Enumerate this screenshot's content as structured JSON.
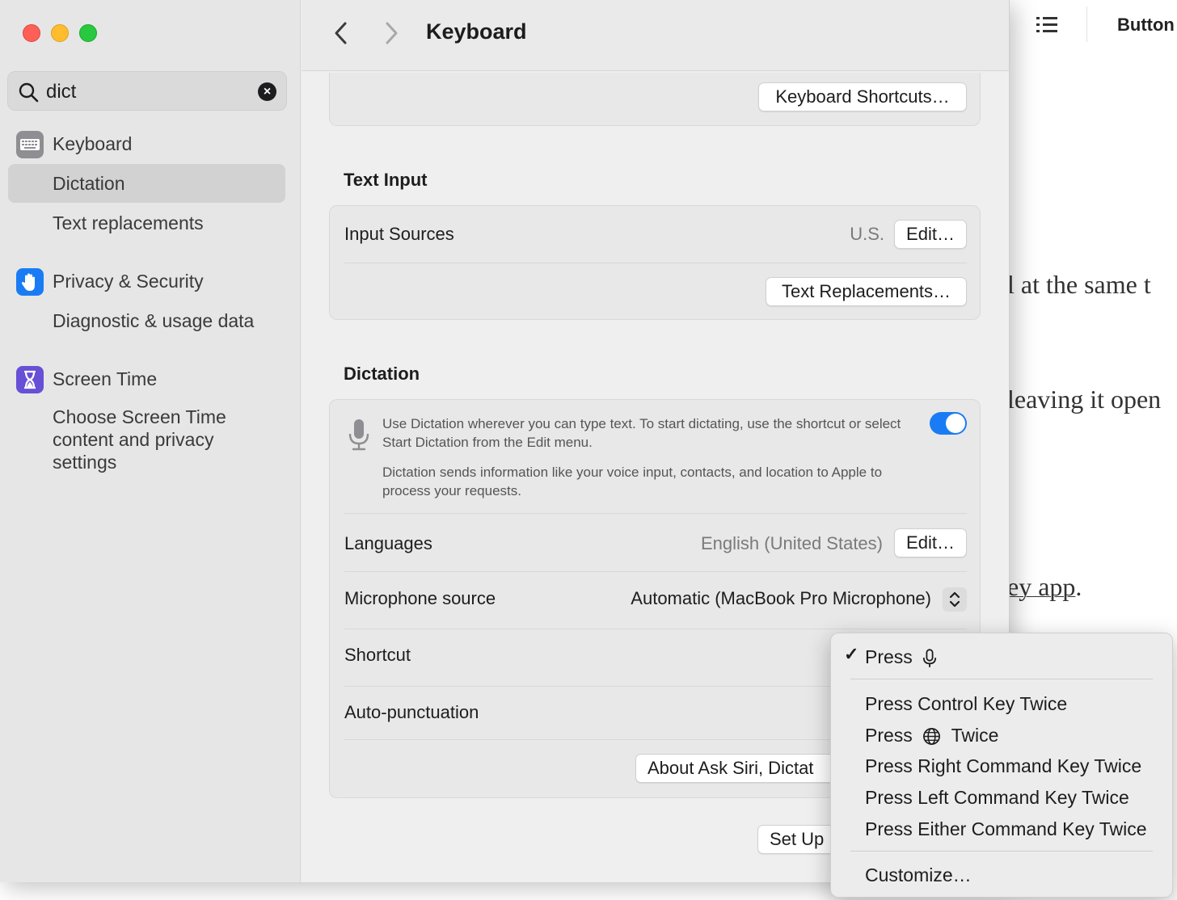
{
  "background_app": {
    "toolbar_button_label": "Button",
    "text_line_1": "l at the same t",
    "text_line_2": "leaving it open",
    "text_line_3_link": "ey app",
    "text_line_3_tail": "."
  },
  "sidebar": {
    "search": {
      "value": "dict"
    },
    "items": [
      {
        "label": "Keyboard",
        "icon": "keyboard-icon"
      },
      {
        "label": "Dictation",
        "selected": true
      },
      {
        "label": "Text replacements"
      },
      {
        "label": "Privacy & Security",
        "icon": "hand-icon"
      },
      {
        "label": "Diagnostic & usage data"
      },
      {
        "label": "Screen Time",
        "icon": "hourglass-icon"
      },
      {
        "label": "Choose Screen Time content and privacy settings"
      }
    ]
  },
  "header": {
    "title": "Keyboard"
  },
  "keyboard_shortcuts_button": "Keyboard Shortcuts…",
  "text_input": {
    "section_title": "Text Input",
    "input_sources_label": "Input Sources",
    "input_sources_value": "U.S.",
    "edit_label": "Edit…",
    "text_replacements_button": "Text Replacements…"
  },
  "dictation": {
    "section_title": "Dictation",
    "description_1": "Use Dictation wherever you can type text. To start dictating, use the shortcut or select Start Dictation from the Edit menu.",
    "description_2": "Dictation sends information like your voice input, contacts, and location to Apple to process your requests.",
    "enabled": true,
    "languages_label": "Languages",
    "languages_value": "English (United States)",
    "languages_edit": "Edit…",
    "microphone_label": "Microphone source",
    "microphone_value": "Automatic (MacBook Pro Microphone)",
    "shortcut_label": "Shortcut",
    "autopunctuation_label": "Auto-punctuation",
    "about_button": "About Ask Siri, Dictat",
    "setup_button": "Set Up"
  },
  "shortcut_menu": {
    "items": [
      {
        "label": "Press",
        "icon": "microphone-icon",
        "checked": true
      },
      {
        "label": "Press Control Key Twice"
      },
      {
        "label": "Press",
        "icon": "globe-icon",
        "suffix": "Twice"
      },
      {
        "label": "Press Right Command Key Twice"
      },
      {
        "label": "Press Left Command Key Twice"
      },
      {
        "label": "Press Either Command Key Twice"
      },
      {
        "label": "Customize…"
      }
    ],
    "check_glyph": "✓"
  },
  "colors": {
    "accent": "#1a7cf5",
    "traffic_close": "#fe5f57",
    "traffic_min": "#febc2e",
    "traffic_max": "#28c840",
    "privacy_icon": "#1a7cf5",
    "screentime_icon": "#6750d6"
  }
}
